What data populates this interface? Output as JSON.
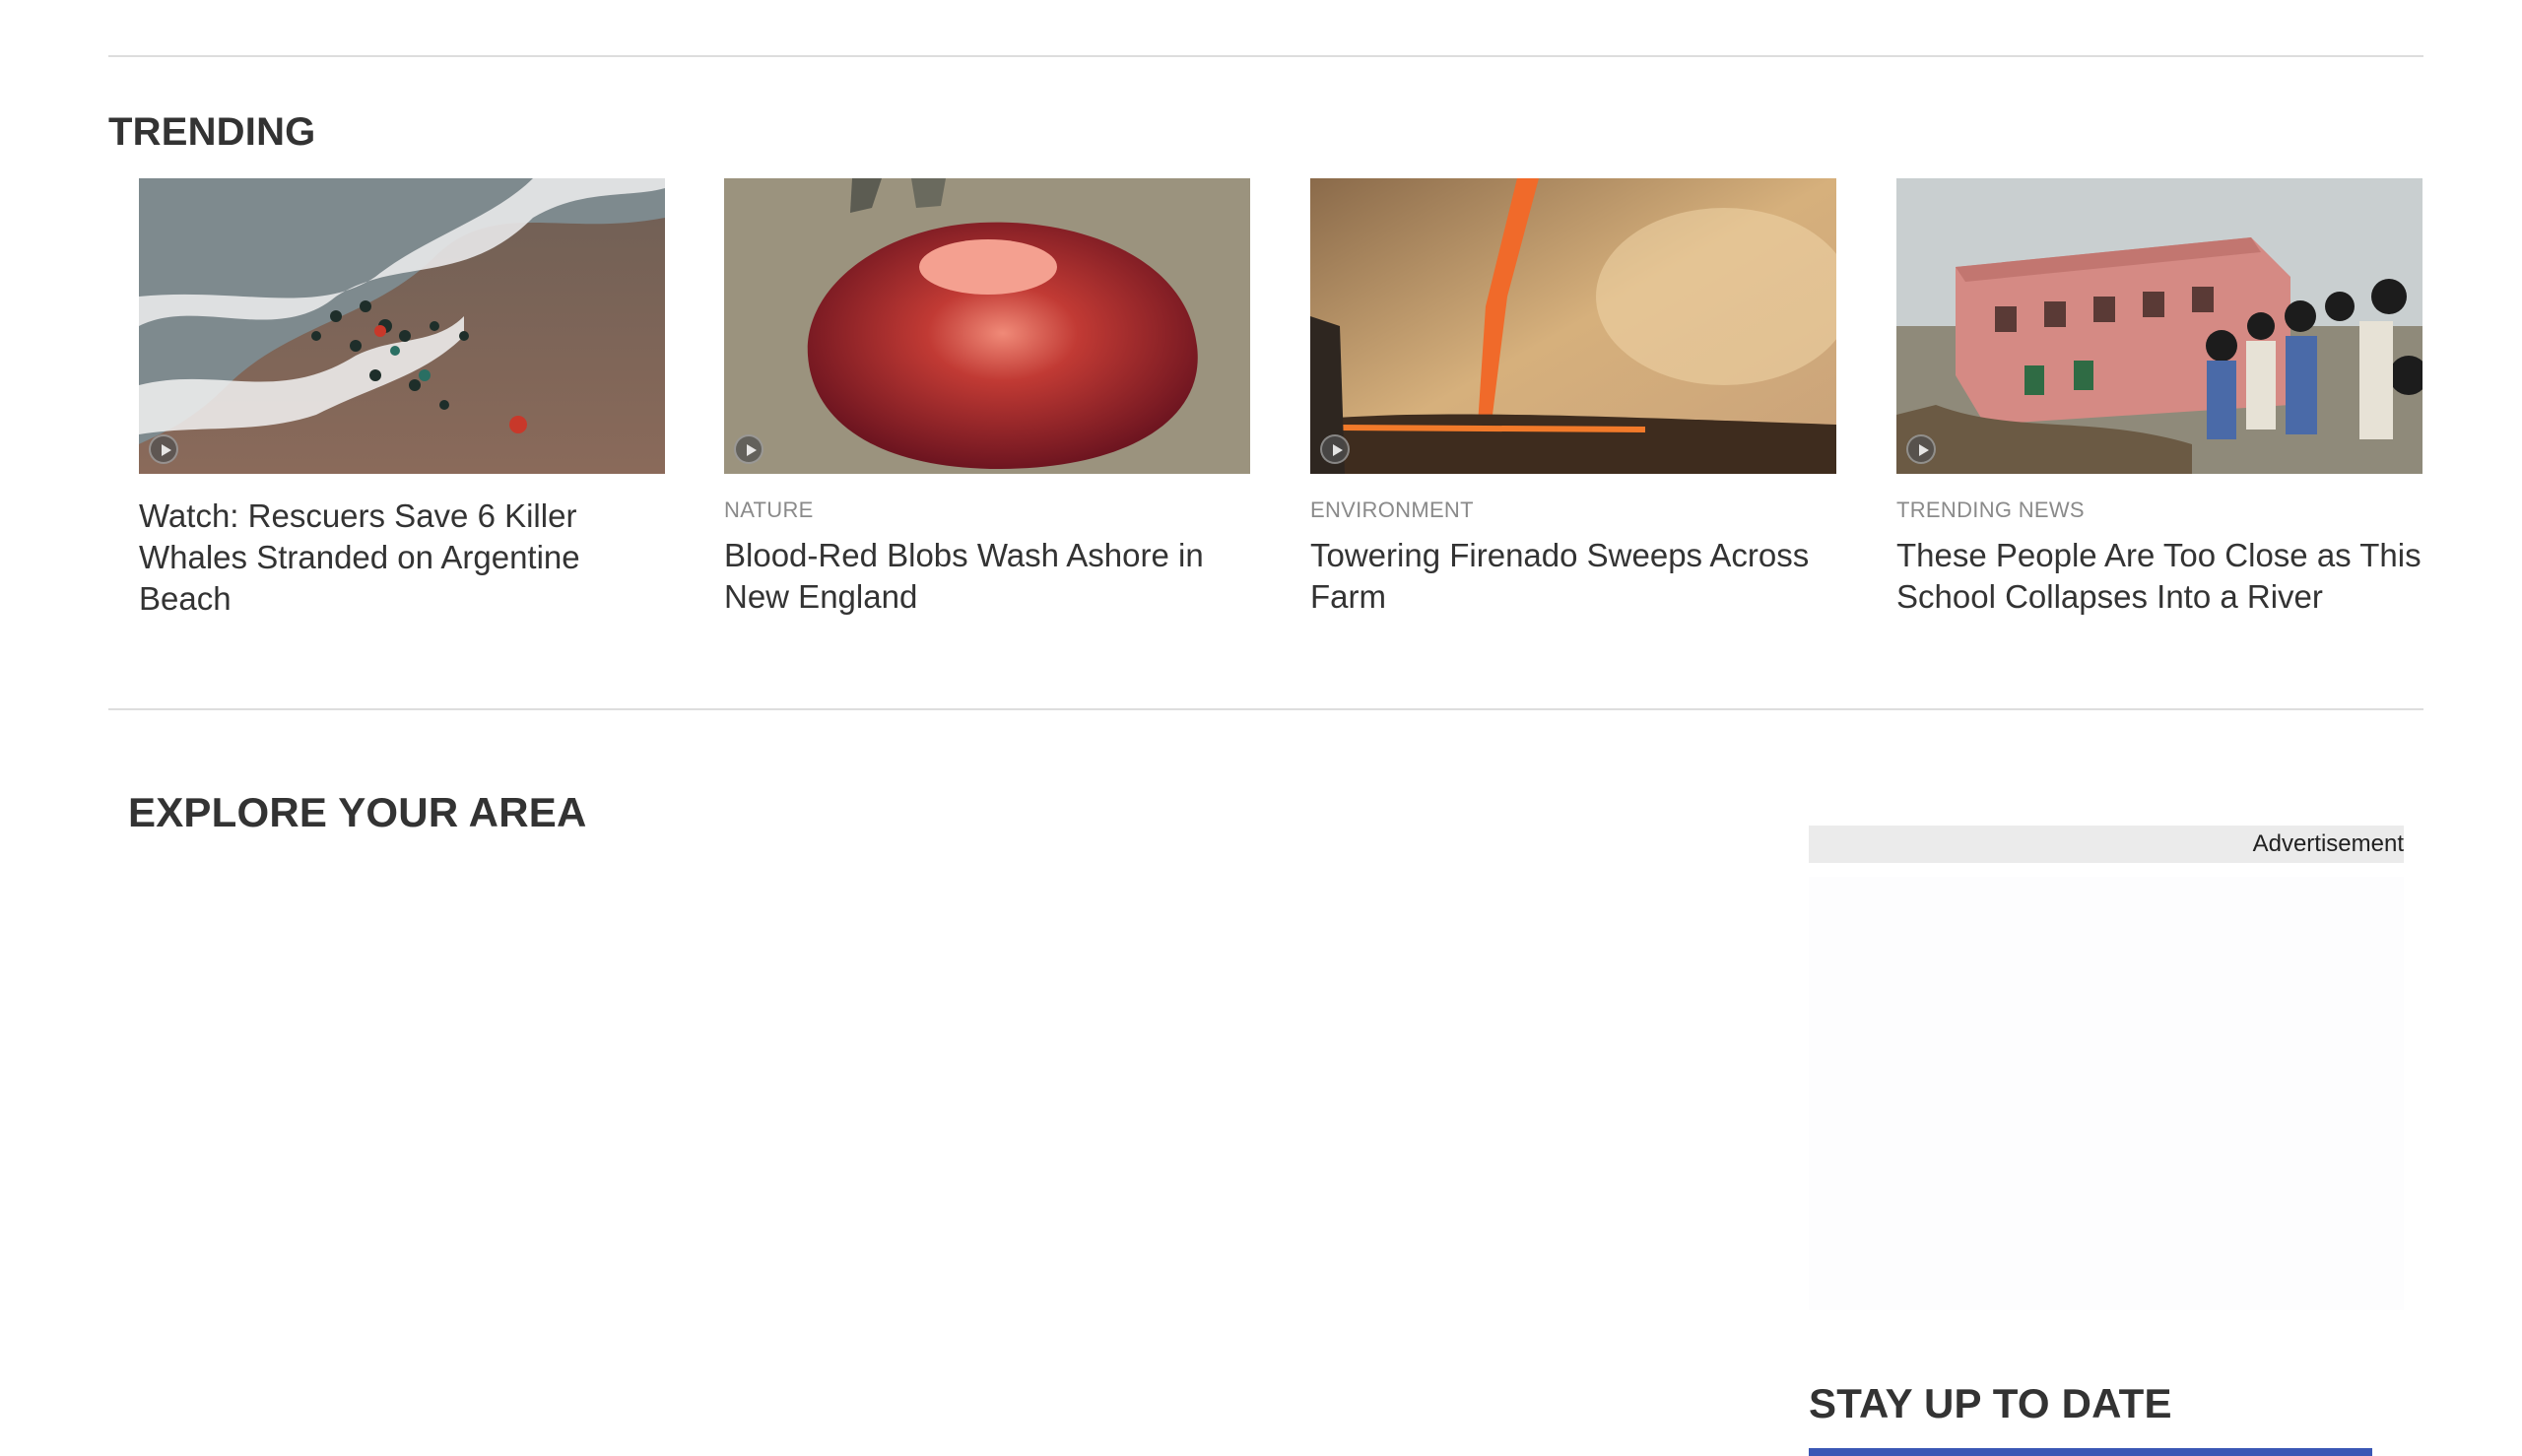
{
  "trending": {
    "heading": "TRENDING",
    "cards": [
      {
        "category": "",
        "title": "Watch: Rescuers Save 6 Killer Whales Stranded on Argentine Beach",
        "has_video": true
      },
      {
        "category": "NATURE",
        "title": "Blood-Red Blobs Wash Ashore in New England",
        "has_video": true
      },
      {
        "category": "ENVIRONMENT",
        "title": "Towering Firenado Sweeps Across Farm",
        "has_video": true
      },
      {
        "category": "TRENDING NEWS",
        "title": "These People Are Too Close as This School Collapses Into a River",
        "has_video": true
      }
    ]
  },
  "explore": {
    "heading": "EXPLORE YOUR AREA"
  },
  "ad": {
    "label": "Advertisement"
  },
  "stay": {
    "heading": "STAY UP TO DATE"
  },
  "colors": {
    "accent": "#3a57b5",
    "rule": "#dddddd",
    "text": "#333333",
    "muted": "#8a8a8a"
  },
  "icons": {
    "video": "play-icon"
  }
}
